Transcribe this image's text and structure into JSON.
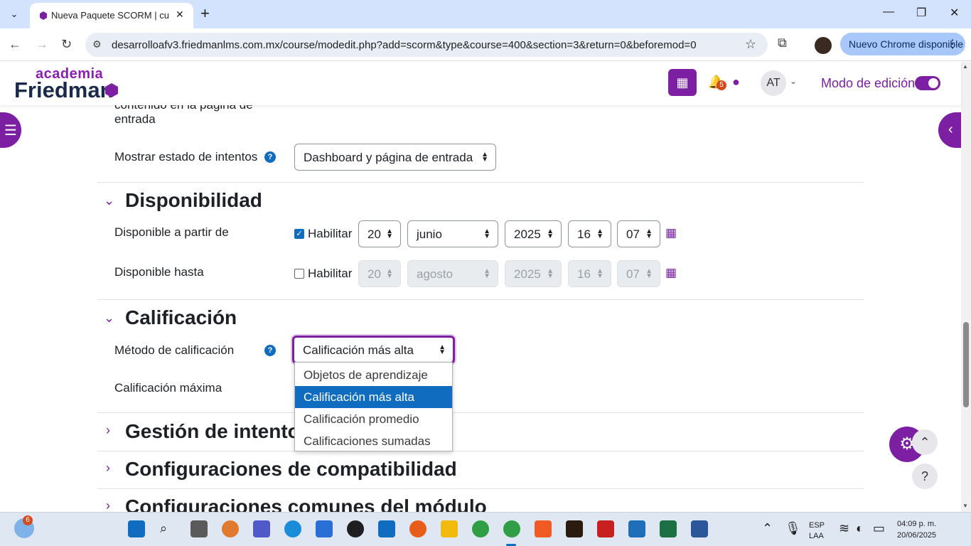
{
  "browser": {
    "tab_title": "Nueva Paquete SCORM | curso",
    "url": "desarrolloafv3.friedmanlms.com.mx/course/modedit.php?add=scorm&type&course=400&section=3&return=0&beforemod=0",
    "chrome_update_label": "Nuevo Chrome disponible"
  },
  "header": {
    "logo_top": "academia",
    "logo_main": "Friedman",
    "notification_count": "5",
    "avatar_initials": "AT",
    "edit_mode_label": "Modo de edición",
    "edit_mode_on": true
  },
  "form": {
    "prev_label_fragment_1": "contenido en la página de",
    "prev_label_fragment_2": "entrada",
    "attempt_status_label": "Mostrar estado de intentos",
    "attempt_status_value": "Dashboard y página de entrada",
    "availability": {
      "title": "Disponibilidad",
      "from_label": "Disponible a partir de",
      "from_enable_label": "Habilitar",
      "from_enabled": true,
      "from_day": "20",
      "from_month": "junio",
      "from_year": "2025",
      "from_hour": "16",
      "from_minute": "07",
      "until_label": "Disponible hasta",
      "until_enable_label": "Habilitar",
      "until_enabled": false,
      "until_day": "20",
      "until_month": "agosto",
      "until_year": "2025",
      "until_hour": "16",
      "until_minute": "07"
    },
    "grading": {
      "title": "Calificación",
      "method_label": "Método de calificación",
      "method_value": "Calificación más alta",
      "max_label": "Calificación máxima",
      "options": [
        "Objetos de aprendizaje",
        "Calificación más alta",
        "Calificación promedio",
        "Calificaciones sumadas"
      ],
      "selected_index": 1
    },
    "collapsed_sections": [
      "Gestión de intentos",
      "Configuraciones de compatibilidad",
      "Configuraciones comunes del módulo"
    ]
  },
  "taskbar": {
    "weather_badge": "6",
    "lang_top": "ESP",
    "lang_bottom": "LAA",
    "time": "04:09 p. m.",
    "date": "20/06/2025"
  },
  "colors": {
    "brand": "#7c1fa3",
    "primary": "#0f6cbf",
    "tabbar": "#d3e3fd"
  }
}
